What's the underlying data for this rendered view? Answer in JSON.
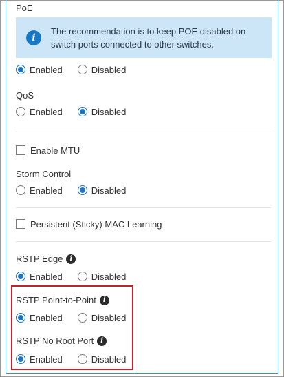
{
  "poe": {
    "label": "PoE",
    "info_text": "The recommendation is to keep POE disabled on switch ports connected to other switches.",
    "info_icon": "info-circle-icon",
    "options": [
      "Enabled",
      "Disabled"
    ],
    "selected": "Enabled"
  },
  "qos": {
    "label": "QoS",
    "options": [
      "Enabled",
      "Disabled"
    ],
    "selected": "Disabled"
  },
  "mtu": {
    "label": "Enable MTU",
    "checked": false
  },
  "storm_control": {
    "label": "Storm Control",
    "options": [
      "Enabled",
      "Disabled"
    ],
    "selected": "Disabled"
  },
  "mac_learning": {
    "label": "Persistent (Sticky) MAC Learning",
    "checked": false
  },
  "rstp_edge": {
    "label": "RSTP Edge",
    "options": [
      "Enabled",
      "Disabled"
    ],
    "selected": "Enabled"
  },
  "rstp_p2p": {
    "label": "RSTP Point-to-Point",
    "options": [
      "Enabled",
      "Disabled"
    ],
    "selected": "Enabled"
  },
  "rstp_no_root": {
    "label": "RSTP No Root Port",
    "options": [
      "Enabled",
      "Disabled"
    ],
    "selected": "Enabled"
  },
  "colors": {
    "accent": "#1f76c4",
    "info_bg": "#cce6f8",
    "highlight": "#c8202b",
    "panel_border": "#3d8ed0"
  }
}
